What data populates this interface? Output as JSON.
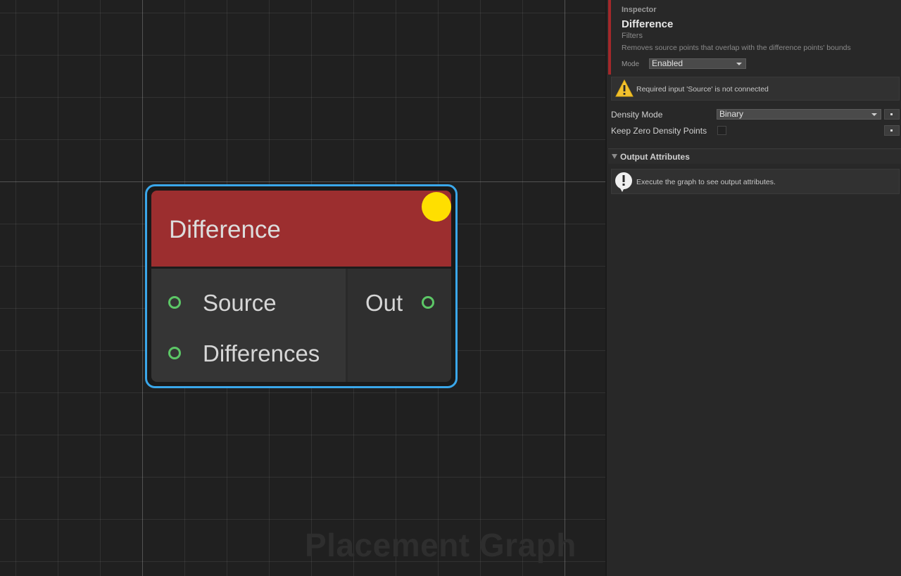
{
  "graph": {
    "watermark": "Placement Graph"
  },
  "node": {
    "title": "Difference",
    "header_color": "#9c2e2f",
    "status_color": "#ffdf00",
    "selection_color": "#3aa7ea",
    "inputs": [
      "Source",
      "Differences"
    ],
    "outputs": [
      "Out"
    ],
    "pin_color": "#5cc766"
  },
  "inspector": {
    "label": "Inspector",
    "node_title": "Difference",
    "category": "Filters",
    "description": "Removes source points that overlap with the difference points' bounds",
    "mode_label": "Mode",
    "mode_value": "Enabled",
    "warning_icon": "warning-icon",
    "warning_text": "Required input 'Source' is not connected",
    "density_mode_label": "Density Mode",
    "density_mode_value": "Binary",
    "keep_zero_label": "Keep Zero Density Points",
    "keep_zero_checked": false,
    "output_section_title": "Output Attributes",
    "info_icon": "info-icon",
    "info_text": "Execute the graph to see output attributes.",
    "accent_color": "#a3282a"
  }
}
